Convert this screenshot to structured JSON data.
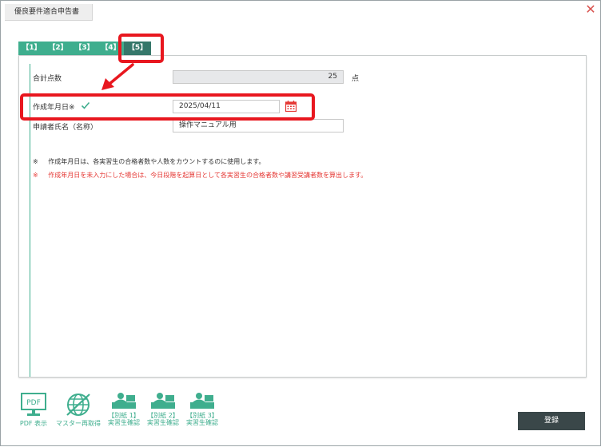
{
  "window": {
    "title": "優良要件適合申告書"
  },
  "tabs": [
    {
      "label": "【1】"
    },
    {
      "label": "【2】"
    },
    {
      "label": "【3】"
    },
    {
      "label": "【4】"
    },
    {
      "label": "【5】",
      "active": true
    }
  ],
  "form": {
    "total_score": {
      "label": "合計点数",
      "value": "25",
      "unit": "点"
    },
    "created_date": {
      "label": "作成年月日※",
      "checked": true,
      "value": "2025/04/11"
    },
    "applicant_name": {
      "label": "申請者氏名（名称）",
      "value": "操作マニュアル用"
    }
  },
  "notes": [
    {
      "mark": "※",
      "text": "作成年月日は、各実習生の合格者数や人数をカウントするのに使用します。",
      "color": "#333333"
    },
    {
      "mark": "※",
      "text": "作成年月日を未入力にした場合は、今日段階を起算日として各実習生の合格者数や講習受講者数を算出します。",
      "color": "#e53935"
    }
  ],
  "toolbar": {
    "pdf": {
      "icon_text": "PDF",
      "label": "PDF 表示"
    },
    "master": {
      "label": "マスター再取得"
    },
    "annex1": {
      "line1": "【別紙 1】",
      "line2": "実習生確認"
    },
    "annex2": {
      "line1": "【別紙 2】",
      "line2": "実習生確認"
    },
    "annex3": {
      "line1": "【別紙 3】",
      "line2": "実習生確認"
    }
  },
  "buttons": {
    "register": "登録"
  },
  "colors": {
    "accent": "#3fae8e",
    "tab_active": "#36776a",
    "highlight": "#e8171f",
    "register_bg": "#3a4749",
    "warning_text": "#e53935"
  }
}
